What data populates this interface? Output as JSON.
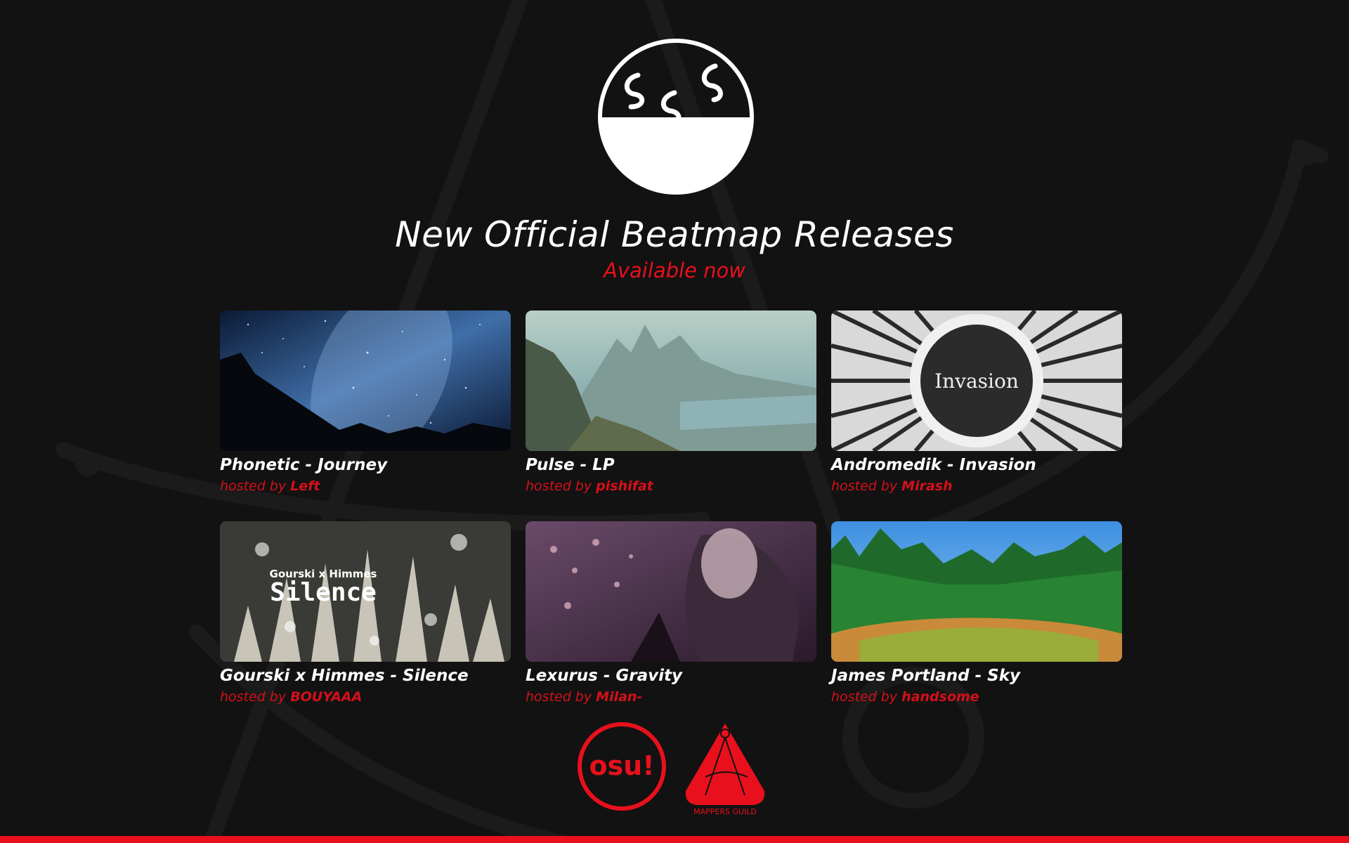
{
  "header": {
    "title": "New Official Beatmap Releases",
    "subtitle": "Available now"
  },
  "cards": [
    {
      "title": "Phonetic - Journey",
      "host_prefix": "hosted by",
      "host": "Left",
      "image": "starry-night-sky"
    },
    {
      "title": "Pulse - LP",
      "host_prefix": "hosted by",
      "host": "pishifat",
      "image": "mountain-landscape-painting"
    },
    {
      "title": "Andromedik - Invasion",
      "host_prefix": "hosted by",
      "host": "Mirash",
      "image": "invasion-pattern",
      "image_text": "Invasion"
    },
    {
      "title": "Gourski x Himmes - Silence",
      "host_prefix": "hosted by",
      "host": "BOUYAAA",
      "image": "crystal-pillars",
      "image_text_top": "Gourski x Himmes",
      "image_text": "Silence"
    },
    {
      "title": "Lexurus - Gravity",
      "host_prefix": "hosted by",
      "host": "Milan-",
      "image": "anime-blossom"
    },
    {
      "title": "James Portland - Sky",
      "host_prefix": "hosted by",
      "host": "handsome",
      "image": "forest-field"
    }
  ],
  "footer": {
    "osu_logo_text": "osu!",
    "guild_logo_text": "MAPPERS GUILD"
  },
  "colors": {
    "accent": "#e8101c",
    "background": "#121212",
    "text": "#ffffff"
  }
}
